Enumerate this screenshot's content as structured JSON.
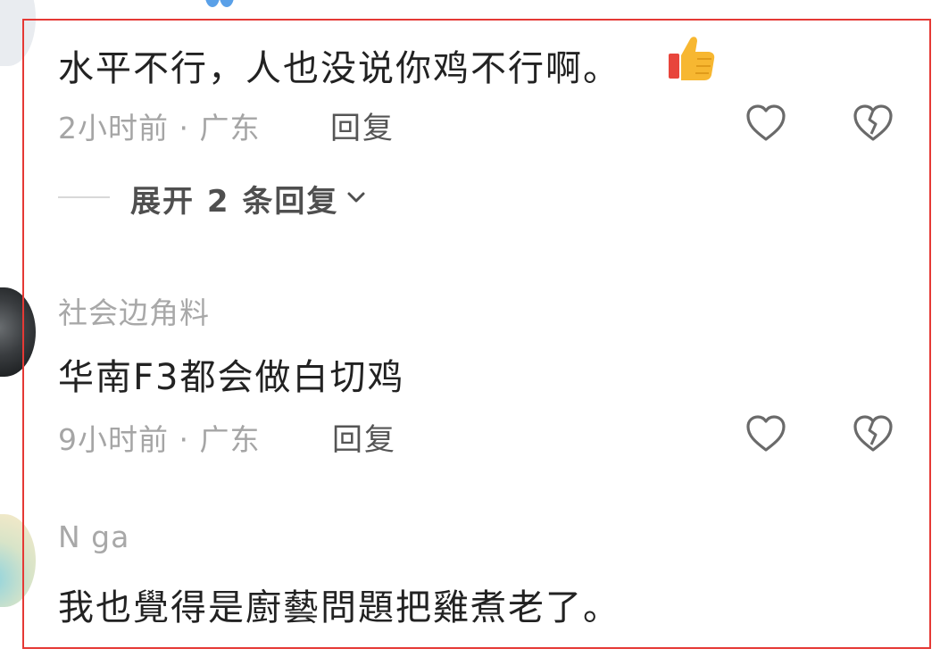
{
  "comments": [
    {
      "username": "",
      "text": "水平不行，人也没说你鸡不行啊。",
      "meta": "2小时前 · 广东",
      "reply_label": "回复",
      "expand_label": "展开 2 条回复"
    },
    {
      "username": "社会边角料",
      "text": "华南F3都会做白切鸡",
      "meta": "9小时前 · 广东",
      "reply_label": "回复"
    },
    {
      "username": "N ga",
      "text": "我也覺得是廚藝問題把雞煮老了。"
    }
  ],
  "icons": {
    "like": "heart-outline-icon",
    "dislike": "broken-heart-icon",
    "thumb": "thumbs-up-emoji",
    "expand": "chevron-down-icon"
  },
  "colors": {
    "highlight_frame": "#e53935",
    "primary_text": "#222222",
    "secondary_text": "#a5a5a5",
    "icon": "#6a6a6a"
  }
}
